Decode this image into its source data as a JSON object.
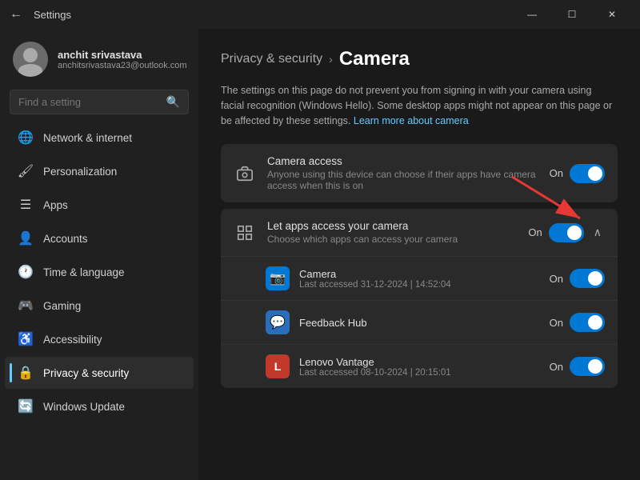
{
  "titlebar": {
    "title": "Settings",
    "back_btn": "←",
    "minimize": "—",
    "maximize": "☐",
    "close": "✕"
  },
  "sidebar": {
    "search_placeholder": "Find a setting",
    "user": {
      "name": "anchit srivastava",
      "email": "anchitsrivastava23@outlook.com"
    },
    "nav_items": [
      {
        "id": "network",
        "label": "Network & internet",
        "icon": "🌐"
      },
      {
        "id": "personalization",
        "label": "Personalization",
        "icon": "🖌"
      },
      {
        "id": "apps",
        "label": "Apps",
        "icon": "☰"
      },
      {
        "id": "accounts",
        "label": "Accounts",
        "icon": "👤"
      },
      {
        "id": "time",
        "label": "Time & language",
        "icon": "🕐"
      },
      {
        "id": "gaming",
        "label": "Gaming",
        "icon": "🎮"
      },
      {
        "id": "accessibility",
        "label": "Accessibility",
        "icon": "♿"
      },
      {
        "id": "privacy",
        "label": "Privacy & security",
        "icon": "🔒"
      },
      {
        "id": "windows-update",
        "label": "Windows Update",
        "icon": "🔄"
      }
    ]
  },
  "main": {
    "breadcrumb_parent": "Privacy & security",
    "breadcrumb_arrow": "›",
    "breadcrumb_current": "Camera",
    "description": "The settings on this page do not prevent you from signing in with your camera using facial recognition (Windows Hello). Some desktop apps might not appear on this page or be affected by these settings.",
    "learn_more_link": "Learn more about camera",
    "camera_access": {
      "title": "Camera access",
      "subtitle": "Anyone using this device can choose if their apps have camera access when this is on",
      "status": "On",
      "toggled": true
    },
    "let_apps": {
      "title": "Let apps access your camera",
      "subtitle": "Choose which apps can access your camera",
      "status": "On",
      "toggled": true
    },
    "apps": [
      {
        "name": "Camera",
        "accessed": "Last accessed 31-12-2024 | 14:52:04",
        "status": "On",
        "toggled": true,
        "icon_type": "camera"
      },
      {
        "name": "Feedback Hub",
        "accessed": "",
        "status": "On",
        "toggled": true,
        "icon_type": "feedback"
      },
      {
        "name": "Lenovo Vantage",
        "accessed": "Last accessed 08-10-2024 | 20:15:01",
        "status": "On",
        "toggled": true,
        "icon_type": "lenovo"
      }
    ]
  }
}
